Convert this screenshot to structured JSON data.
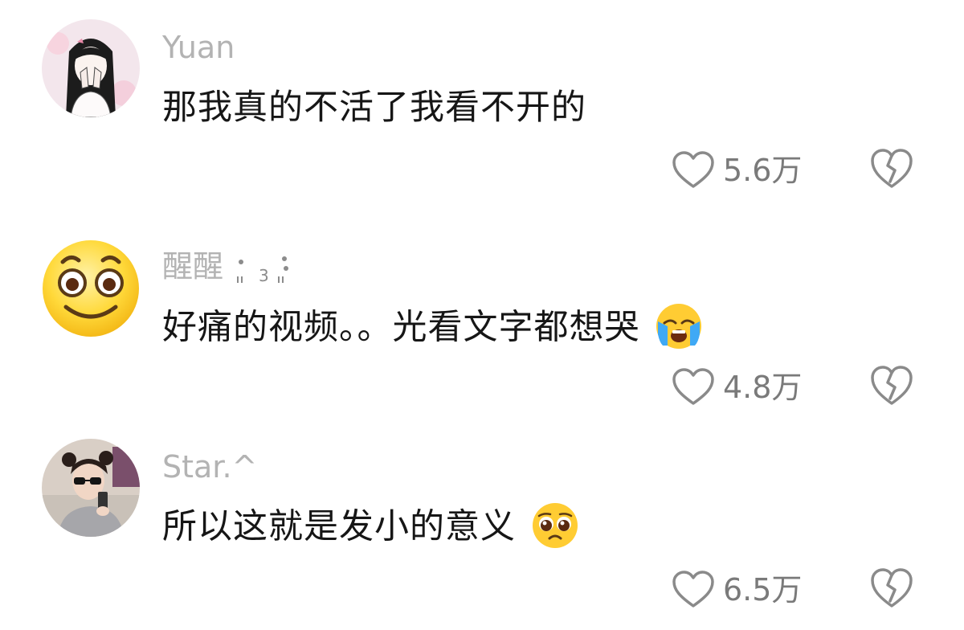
{
  "comments": [
    {
      "username": "Yuan",
      "text": "那我真的不活了我看不开的",
      "like_count": "5.6万",
      "avatar": "girl-covering-face-avatar",
      "emoji": null
    },
    {
      "username": "醒醒",
      "username_decoration": "3",
      "text": "好痛的视频。。光看文字都想哭",
      "like_count": "4.8万",
      "avatar": "smiling-face-avatar",
      "emoji": "loudly-crying-face"
    },
    {
      "username": "Star.^",
      "text": "所以这就是发小的意义",
      "like_count": "6.5万",
      "avatar": "girl-with-sunglasses-avatar",
      "emoji": "pleading-face"
    }
  ],
  "colors": {
    "username": "#b3b3b3",
    "text": "#161616",
    "count": "#7a7a7a",
    "icon_stroke": "#8a8a8a"
  }
}
